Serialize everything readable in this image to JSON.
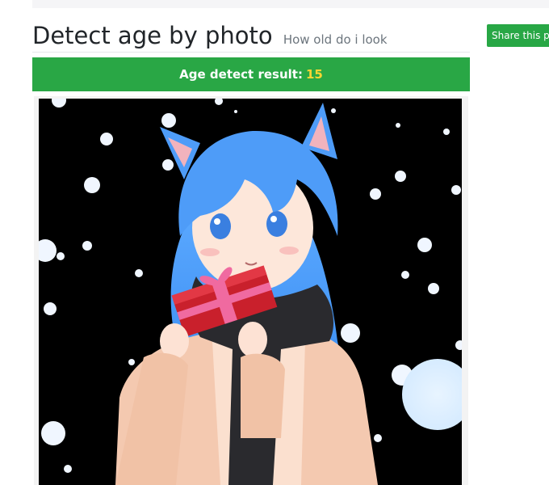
{
  "header": {
    "title": "Detect age by photo",
    "subtitle": "How old do i look"
  },
  "share": {
    "label": "Share this pag"
  },
  "result": {
    "label": "Age detect result:",
    "value": "15"
  },
  "photo": {
    "subject": "anime-girl-holding-gift",
    "background_color": "#000000"
  }
}
